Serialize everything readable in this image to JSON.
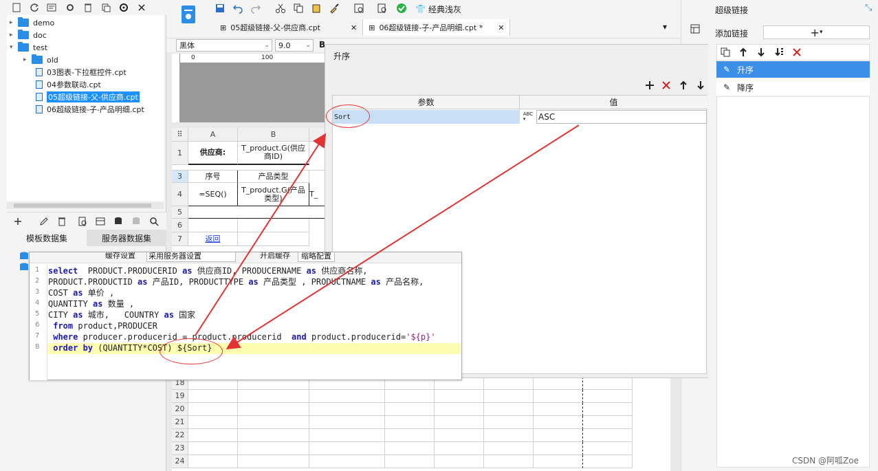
{
  "tree": {
    "items": [
      {
        "label": "demo",
        "type": "folder",
        "arrow": "▸"
      },
      {
        "label": "doc",
        "type": "folder",
        "arrow": "▸"
      },
      {
        "label": "test",
        "type": "folder",
        "arrow": "▾"
      },
      {
        "label": "old",
        "type": "folder",
        "arrow": "▸"
      },
      {
        "label": "03图表-下拉框控件.cpt",
        "type": "file"
      },
      {
        "label": "04参数联动.cpt",
        "type": "file"
      },
      {
        "label": "05超级链接-父-供应商.cpt",
        "type": "file",
        "selected": true
      },
      {
        "label": "06超级链接-子-产品明细.cpt",
        "type": "file"
      }
    ]
  },
  "datasets": {
    "tab_template": "模板数据集",
    "tab_server": "服务器数据集"
  },
  "toolbar": {
    "theme_label": "经典浅灰"
  },
  "doc_tabs": [
    {
      "label": "05超级链接-父-供应商.cpt"
    },
    {
      "label": "06超级链接-子-产品明细.cpt *"
    }
  ],
  "font": {
    "family": "黑体",
    "size": "9.0"
  },
  "ruler": {
    "zero": "0",
    "hundred": "100"
  },
  "sheet": {
    "col_headers": [
      "A",
      "B"
    ],
    "row_numbers": [
      "1",
      "3",
      "4",
      "5",
      "6",
      "7",
      "18",
      "19",
      "20",
      "21",
      "22",
      "23",
      "24"
    ],
    "a1": "供应商:",
    "b1": "T_product.G(供应商ID)",
    "a3": "序号",
    "b3": "产品类型",
    "a4": "=SEQ()",
    "b4": "T_product.G(产品类型)",
    "c4": "T_",
    "a7": "返回"
  },
  "dialog": {
    "title": "升序",
    "col_param": "参数",
    "col_value": "值",
    "row_param": "Sort",
    "row_value": "ASC"
  },
  "right": {
    "title": "超级链接",
    "add_label": "添加链接",
    "items": [
      "升序",
      "降序"
    ]
  },
  "sql": {
    "toolbar_text": "缓存设置",
    "server_setting": "采用服务器设置",
    "enable_cache": "开启缓存",
    "shortcut": "缩略配置",
    "line_numbers": [
      "1",
      "2",
      "3",
      "4",
      "5",
      "6",
      "7",
      "8"
    ]
  },
  "watermark": "CSDN @阿呱Zoe",
  "colors": {
    "accent": "#3c8ee6",
    "folder": "#2a8ee8",
    "annotation": "#e33333",
    "highlight_line": "#fdfdb0"
  }
}
